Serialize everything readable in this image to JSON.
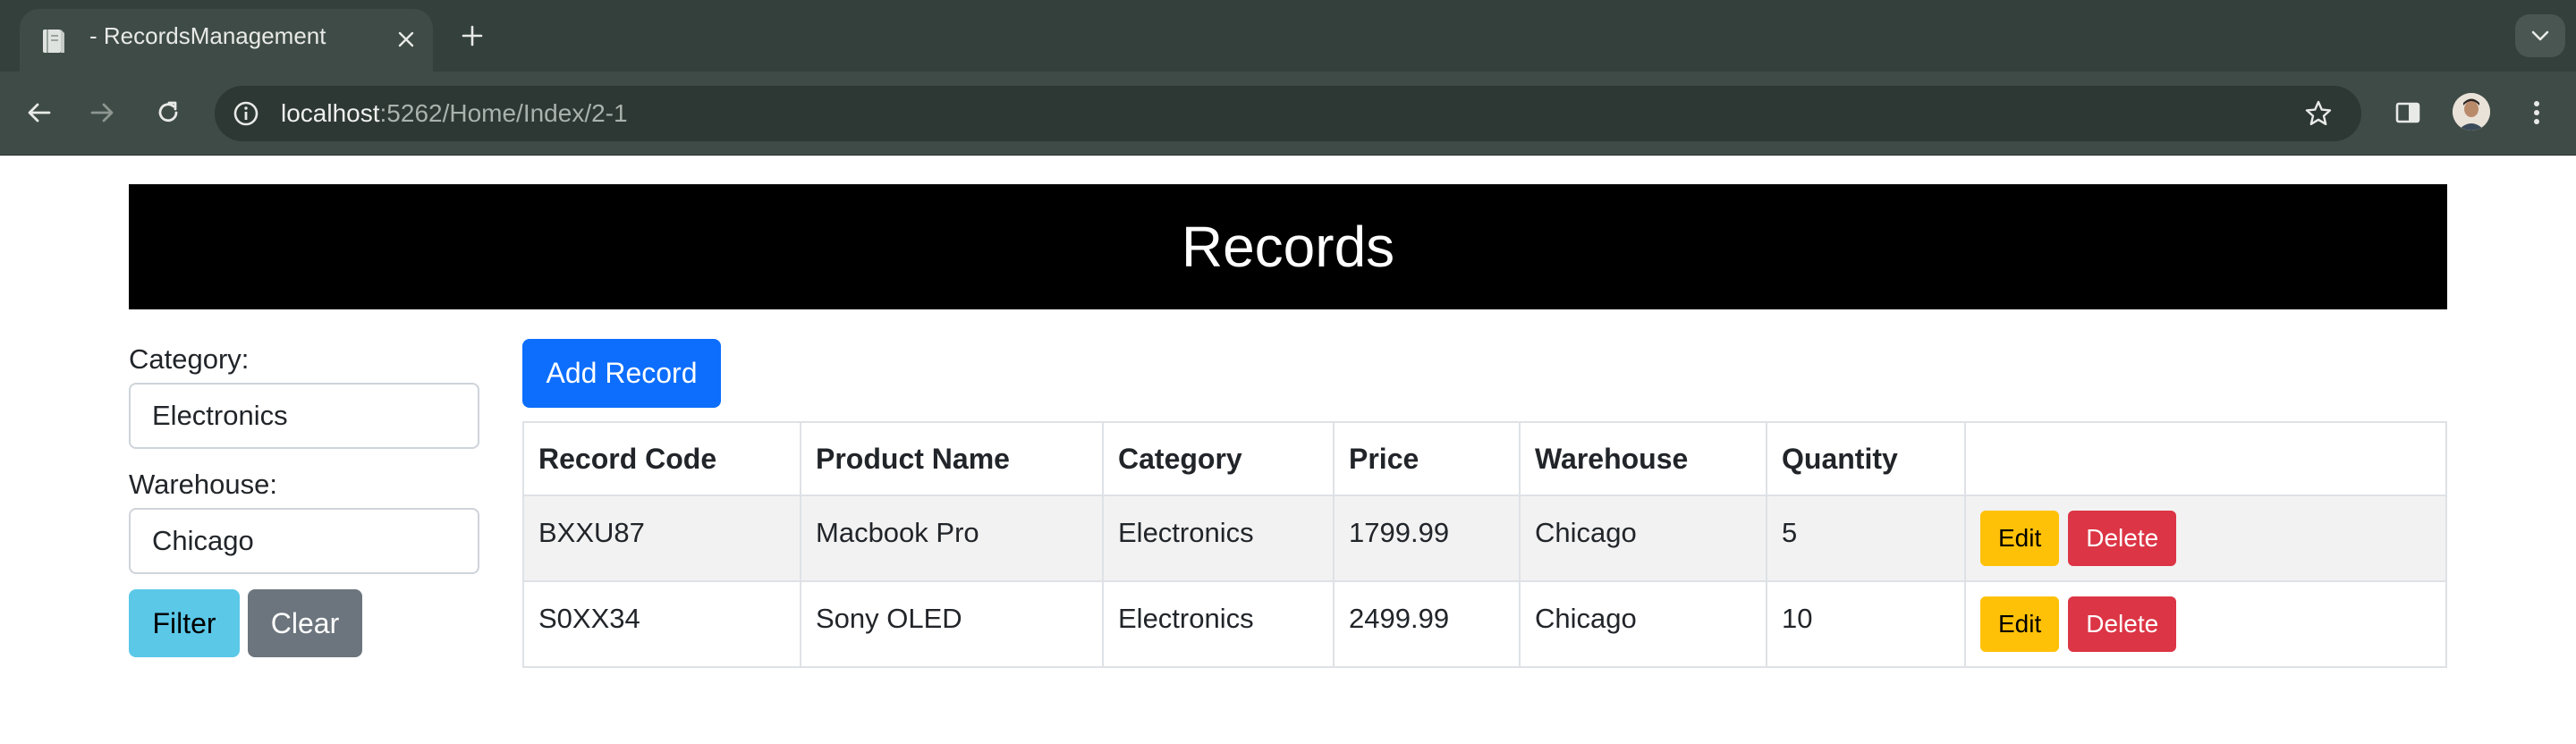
{
  "browser": {
    "tab_title": "- RecordsManagement",
    "url_host": "localhost",
    "url_path": ":5262/Home/Index/2-1"
  },
  "page": {
    "title": "Records",
    "filters": {
      "category_label": "Category:",
      "category_value": "Electronics",
      "warehouse_label": "Warehouse:",
      "warehouse_value": "Chicago",
      "filter_button": "Filter",
      "clear_button": "Clear"
    },
    "add_button": "Add Record",
    "table": {
      "headers": [
        "Record Code",
        "Product Name",
        "Category",
        "Price",
        "Warehouse",
        "Quantity",
        ""
      ],
      "rows": [
        {
          "code": "BXXU87",
          "product": "Macbook Pro",
          "category": "Electronics",
          "price": "1799.99",
          "warehouse": "Chicago",
          "quantity": "5",
          "edit": "Edit",
          "delete": "Delete"
        },
        {
          "code": "S0XX34",
          "product": "Sony OLED",
          "category": "Electronics",
          "price": "2499.99",
          "warehouse": "Chicago",
          "quantity": "10",
          "edit": "Edit",
          "delete": "Delete"
        }
      ]
    }
  },
  "colors": {
    "header_bg": "#000000",
    "primary": "#0d6efd",
    "info": "#5bc8e8",
    "secondary": "#6c757d",
    "warning": "#ffc107",
    "danger": "#dc3545"
  },
  "icons": [
    "document-icon",
    "close-icon",
    "plus-icon",
    "chevron-down-icon",
    "back-arrow-icon",
    "forward-arrow-icon",
    "reload-icon",
    "site-info-icon",
    "star-icon",
    "side-panel-icon",
    "avatar",
    "more-vert-icon"
  ]
}
